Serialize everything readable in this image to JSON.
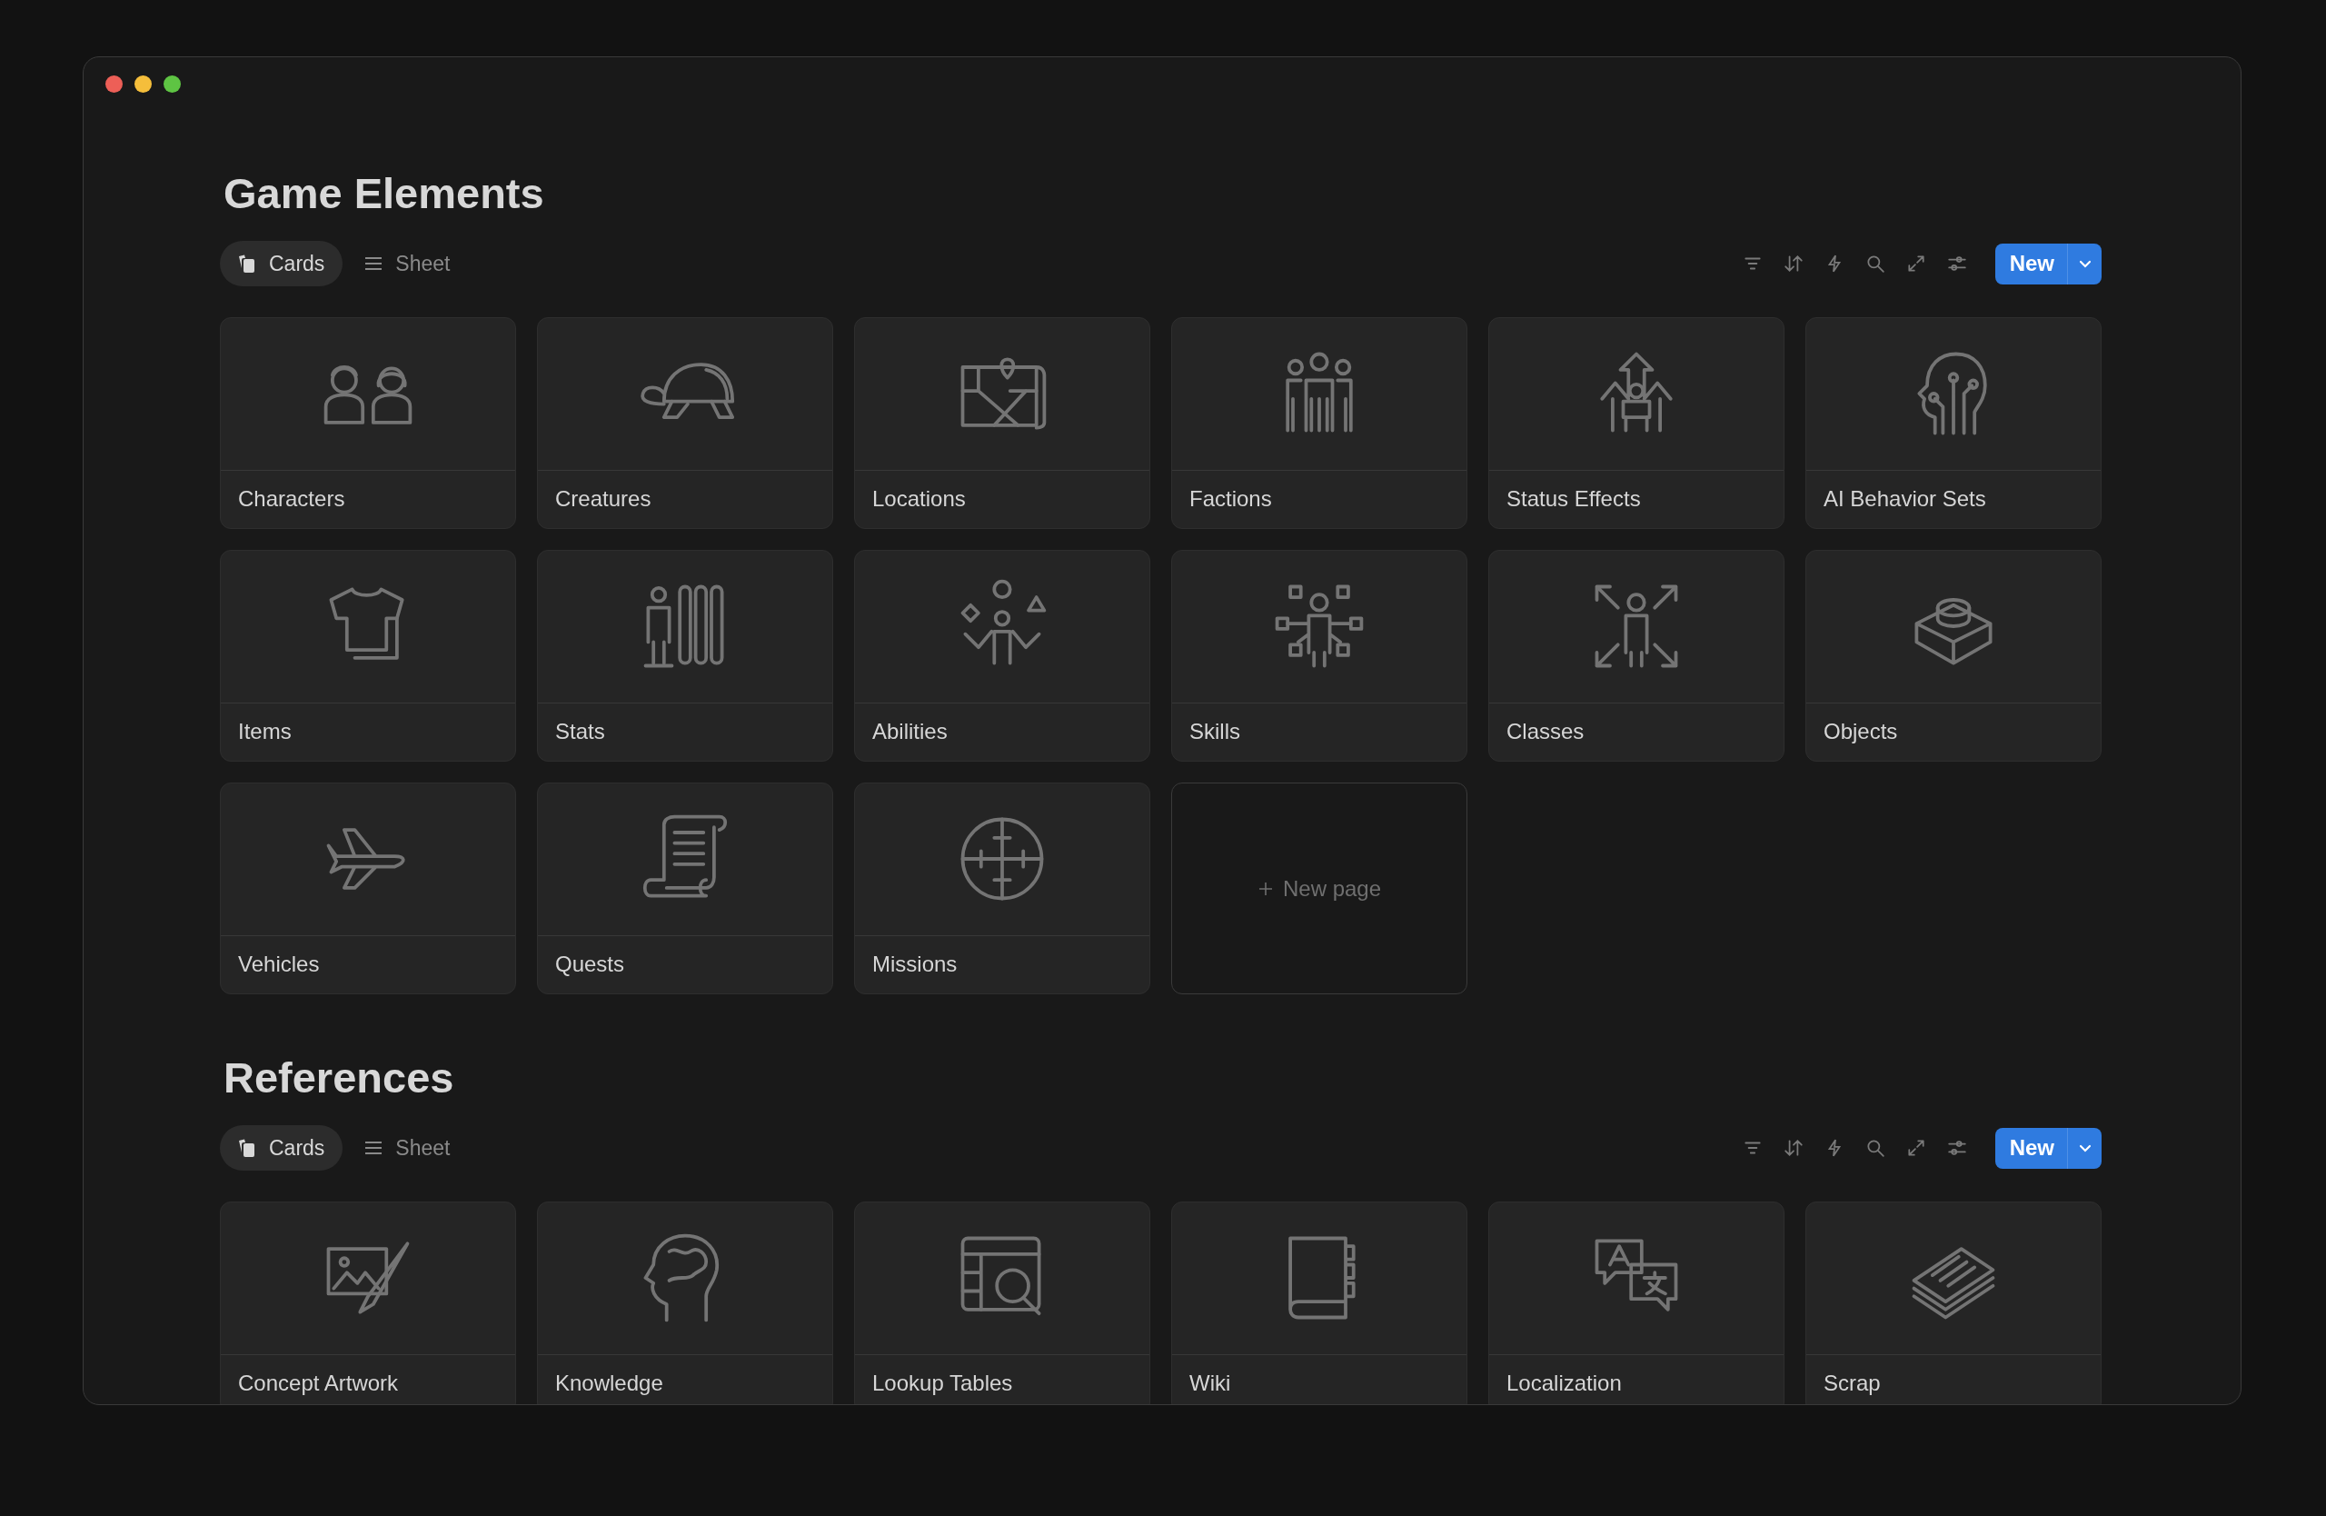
{
  "sections": [
    {
      "title": "Game Elements",
      "views": [
        {
          "label": "Cards",
          "kind": "cards",
          "selected": true
        },
        {
          "label": "Sheet",
          "kind": "sheet",
          "selected": false
        }
      ],
      "new_button": "New",
      "cards": [
        {
          "kind": "page",
          "label": "Characters"
        },
        {
          "kind": "page",
          "label": "Creatures"
        },
        {
          "kind": "page",
          "label": "Locations"
        },
        {
          "kind": "page",
          "label": "Factions"
        },
        {
          "kind": "page",
          "label": "Status Effects"
        },
        {
          "kind": "page",
          "label": "AI Behavior Sets"
        },
        {
          "kind": "page",
          "label": "Items"
        },
        {
          "kind": "page",
          "label": "Stats"
        },
        {
          "kind": "page",
          "label": "Abilities"
        },
        {
          "kind": "page",
          "label": "Skills"
        },
        {
          "kind": "page",
          "label": "Classes"
        },
        {
          "kind": "page",
          "label": "Objects"
        },
        {
          "kind": "page",
          "label": "Vehicles"
        },
        {
          "kind": "page",
          "label": "Quests"
        },
        {
          "kind": "page",
          "label": "Missions"
        },
        {
          "kind": "new",
          "label": "New page"
        }
      ]
    },
    {
      "title": "References",
      "views": [
        {
          "label": "Cards",
          "kind": "cards",
          "selected": true
        },
        {
          "label": "Sheet",
          "kind": "sheet",
          "selected": false
        }
      ],
      "new_button": "New",
      "cards": [
        {
          "kind": "page",
          "label": "Concept Artwork"
        },
        {
          "kind": "page",
          "label": "Knowledge"
        },
        {
          "kind": "page",
          "label": "Lookup Tables"
        },
        {
          "kind": "page",
          "label": "Wiki"
        },
        {
          "kind": "page",
          "label": "Localization"
        },
        {
          "kind": "page",
          "label": "Scrap"
        }
      ]
    }
  ]
}
